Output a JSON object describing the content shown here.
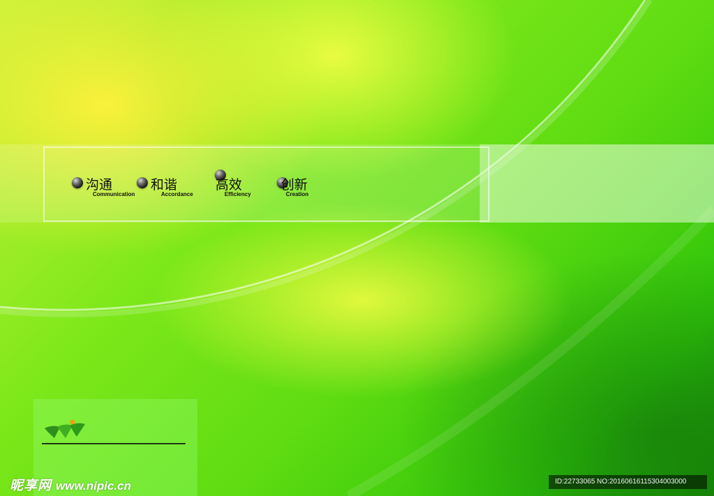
{
  "values": [
    {
      "cn": "沟通",
      "en": "Communication"
    },
    {
      "cn": "和谐",
      "en": "Accordance"
    },
    {
      "cn": "高效",
      "en": "Efficiency"
    },
    {
      "cn": "创新",
      "en": "Creation"
    }
  ],
  "watermark": {
    "brand": "昵享网",
    "url": "www.nipic.cn"
  },
  "image_id": "ID:22733065 NO:20160616115304003000",
  "colors": {
    "bg_light": "#d6f53a",
    "bg_mid": "#6ee012",
    "bg_dark": "#168a06",
    "text": "#111111"
  },
  "icons": {
    "bullet": "sphere-bullet-icon",
    "logo": "company-logo"
  }
}
